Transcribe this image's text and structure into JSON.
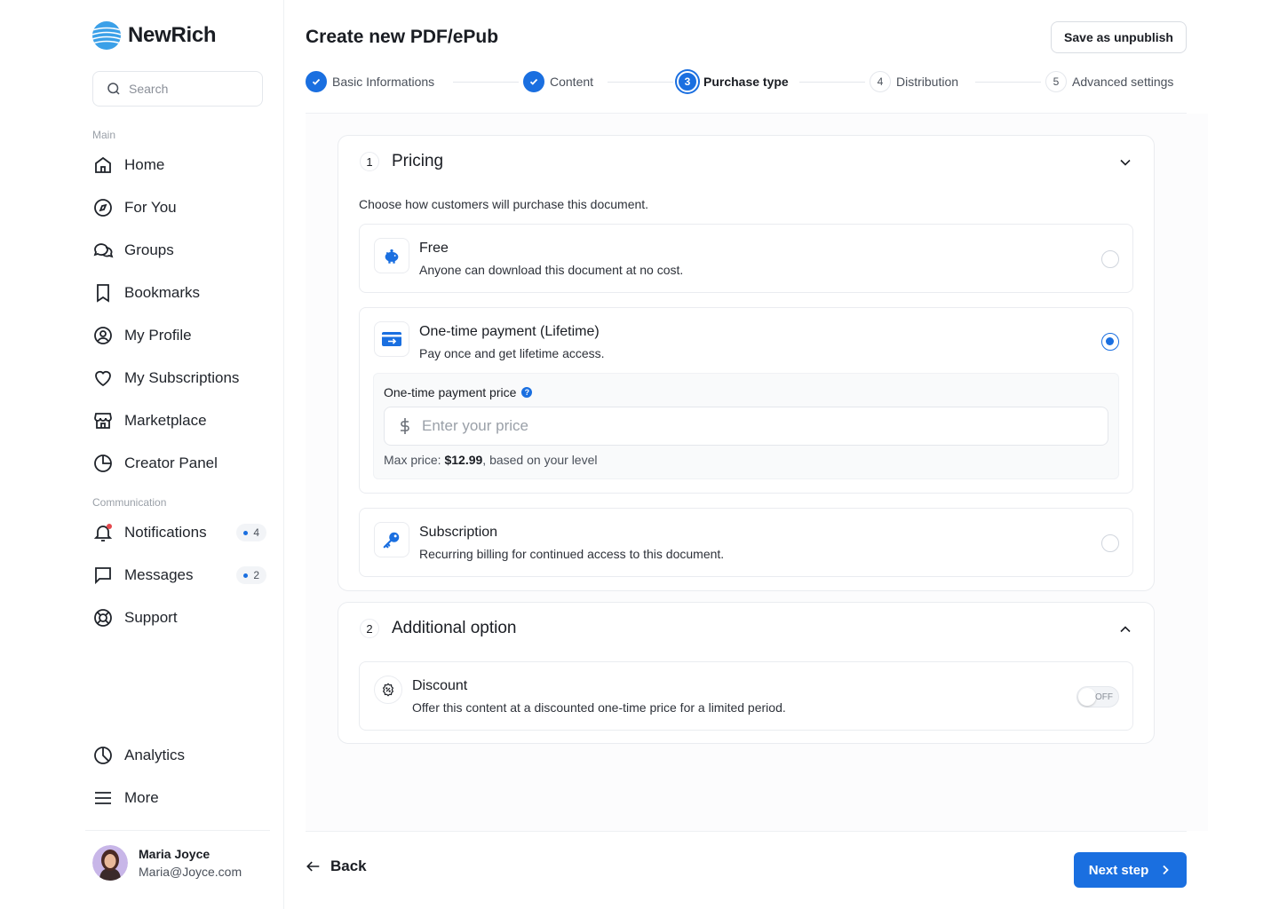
{
  "brand": {
    "name": "NewRich"
  },
  "search": {
    "placeholder": "Search"
  },
  "sidebar": {
    "main_label": "Main",
    "main_items": [
      {
        "label": "Home",
        "icon": "home-icon"
      },
      {
        "label": "For You",
        "icon": "compass-icon"
      },
      {
        "label": "Groups",
        "icon": "chat-bubbles-icon"
      },
      {
        "label": "Bookmarks",
        "icon": "bookmark-icon"
      },
      {
        "label": "My Profile",
        "icon": "user-circle-icon"
      },
      {
        "label": "My Subscriptions",
        "icon": "heart-icon"
      },
      {
        "label": "Marketplace",
        "icon": "store-icon"
      },
      {
        "label": "Creator Panel",
        "icon": "pie-icon"
      }
    ],
    "communication_label": "Communication",
    "communication_items": [
      {
        "label": "Notifications",
        "icon": "bell-icon",
        "badge": "4"
      },
      {
        "label": "Messages",
        "icon": "message-icon",
        "badge": "2"
      },
      {
        "label": "Support",
        "icon": "lifebuoy-icon"
      }
    ],
    "bottom_items": [
      {
        "label": "Analytics",
        "icon": "chart-pie-icon"
      },
      {
        "label": "More",
        "icon": "menu-icon"
      }
    ]
  },
  "user": {
    "name": "Maria Joyce",
    "email": "Maria@Joyce.com"
  },
  "header": {
    "title": "Create new PDF/ePub",
    "save_label": "Save as unpublish"
  },
  "steps": [
    {
      "label": "Basic Informations",
      "number": "1",
      "state": "done"
    },
    {
      "label": "Content",
      "number": "2",
      "state": "done"
    },
    {
      "label": "Purchase type",
      "number": "3",
      "state": "active"
    },
    {
      "label": "Distribution",
      "number": "4",
      "state": "todo"
    },
    {
      "label": "Advanced settings",
      "number": "5",
      "state": "todo"
    }
  ],
  "pricing": {
    "number": "1",
    "title": "Pricing",
    "description": "Choose how customers will purchase this document.",
    "options": [
      {
        "title": "Free",
        "subtitle": "Anyone can download this document at no cost.",
        "selected": false,
        "icon": "piggy-bank-icon"
      },
      {
        "title": "One-time payment (Lifetime)",
        "subtitle": "Pay once and get lifetime access.",
        "selected": true,
        "icon": "card-transfer-icon"
      },
      {
        "title": "Subscription",
        "subtitle": "Recurring billing for continued access to this document.",
        "selected": false,
        "icon": "key-icon"
      }
    ],
    "price_label": "One-time payment price",
    "price_placeholder": "Enter your price",
    "max_price_prefix": "Max price: ",
    "max_price_value": "$12.99",
    "max_price_suffix": ", based on your level"
  },
  "additional": {
    "number": "2",
    "title": "Additional option",
    "discount_title": "Discount",
    "discount_subtitle": "Offer this content at a discounted one-time price for a limited period.",
    "toggle_label": "OFF",
    "toggle_on": false
  },
  "footer": {
    "back_label": "Back",
    "next_label": "Next step"
  },
  "colors": {
    "accent": "#1a6fe0",
    "notification_dot": "#e5484d"
  }
}
